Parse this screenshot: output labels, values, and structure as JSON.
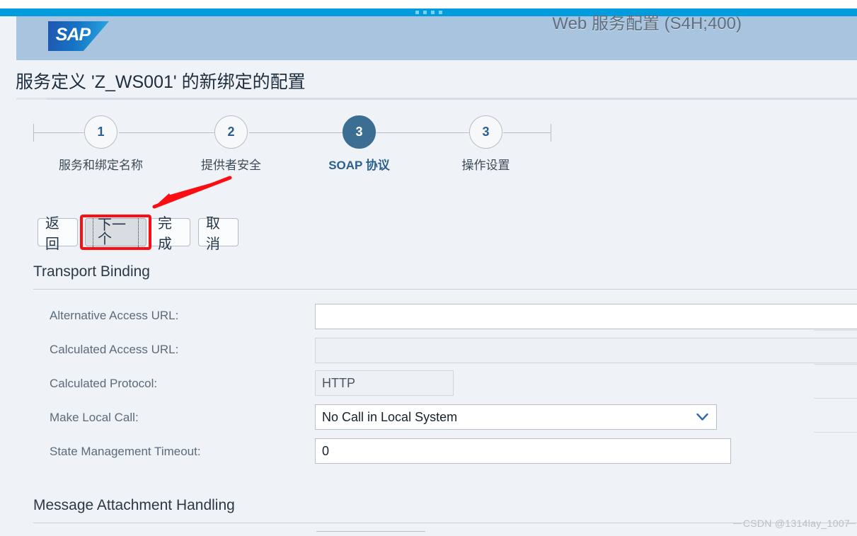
{
  "window": {
    "titlebar_dots": 4
  },
  "header": {
    "logo_text": "SAP",
    "title": "Web 服务配置 (S4H;400)"
  },
  "page": {
    "title": "服务定义 'Z_WS001' 的新绑定的配置"
  },
  "wizard": {
    "steps": [
      {
        "number": "1",
        "label": "服务和绑定名称",
        "active": false
      },
      {
        "number": "2",
        "label": "提供者安全",
        "active": false
      },
      {
        "number": "3",
        "label": "SOAP 协议",
        "active": true
      },
      {
        "number": "3",
        "label": "操作设置",
        "active": false
      }
    ]
  },
  "toolbar": {
    "back_label": "返回",
    "next_label": "下一个",
    "finish_label": "完成",
    "cancel_label": "取消",
    "highlight_color": "#fb0d12",
    "annotation": "red-arrow-pointing-to-next-button"
  },
  "sections": [
    {
      "title": "Transport Binding",
      "fields": [
        {
          "label": "Alternative Access URL:",
          "value": "",
          "type": "text",
          "readonly": false
        },
        {
          "label": "Calculated Access URL:",
          "value": "",
          "type": "text",
          "readonly": true
        },
        {
          "label": "Calculated Protocol:",
          "value": "HTTP",
          "type": "text",
          "readonly": true
        },
        {
          "label": "Make Local Call:",
          "value": "No Call in Local System",
          "type": "select",
          "readonly": false
        },
        {
          "label": "State Management Timeout:",
          "value": "0",
          "type": "text",
          "readonly": false
        }
      ]
    },
    {
      "title": "Message Attachment Handling",
      "fields": []
    }
  ],
  "watermark": "CSDN @1314lay_1007",
  "colors": {
    "accent_blue": "#019cdd",
    "header_band": "#a8c4de",
    "active_step": "#3c6e93",
    "page_bg": "#eff3f7"
  }
}
